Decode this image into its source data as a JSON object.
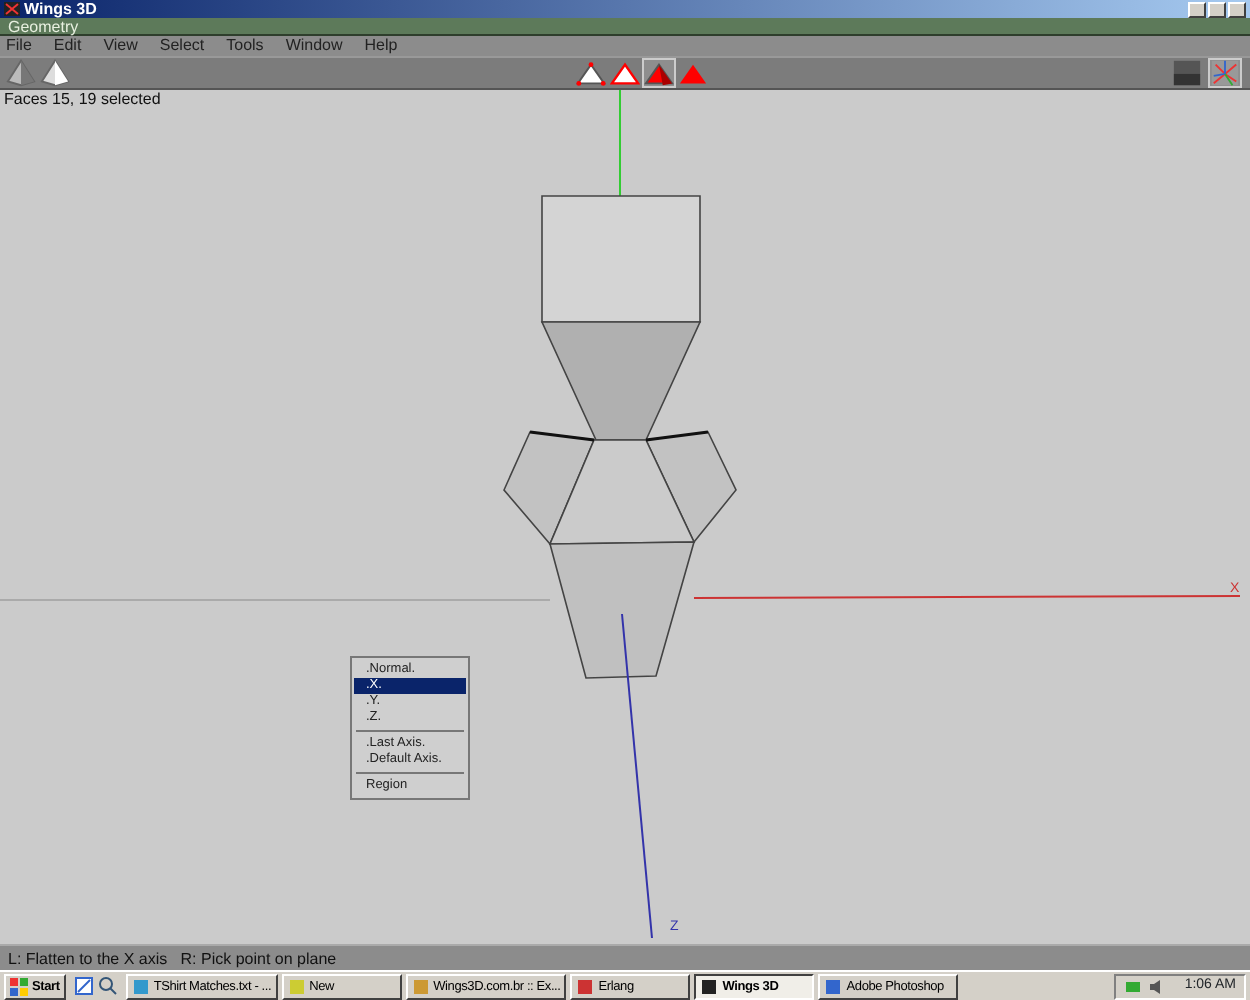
{
  "window": {
    "title": "Wings 3D"
  },
  "geometry_window": {
    "title": "Geometry"
  },
  "menu": [
    "File",
    "Edit",
    "View",
    "Select",
    "Tools",
    "Window",
    "Help"
  ],
  "view_buttons": [
    {
      "kind": "solid"
    },
    {
      "kind": "half"
    }
  ],
  "select_modes": [
    {
      "kind": "vertex",
      "selected": false
    },
    {
      "kind": "edge",
      "selected": false
    },
    {
      "kind": "face",
      "selected": true
    },
    {
      "kind": "body",
      "selected": false
    }
  ],
  "shading_buttons": [
    {
      "kind": "smooth",
      "selected": false
    },
    {
      "kind": "axes",
      "selected": true
    }
  ],
  "viewport": {
    "info": "Faces 15, 19 selected",
    "axis_labels": [
      {
        "kind": "x",
        "text": "X"
      },
      {
        "kind": "z",
        "text": "Z"
      }
    ]
  },
  "popup_menu": [
    {
      "kind": "item",
      "label": ".Normal.",
      "selected": false
    },
    {
      "kind": "item",
      "label": ".X.",
      "selected": true
    },
    {
      "kind": "item",
      "label": ".Y.",
      "selected": false
    },
    {
      "kind": "item",
      "label": ".Z.",
      "selected": false
    },
    {
      "kind": "separator"
    },
    {
      "kind": "item",
      "label": ".Last Axis.",
      "selected": false
    },
    {
      "kind": "item",
      "label": ".Default Axis.",
      "selected": false
    },
    {
      "kind": "separator"
    },
    {
      "kind": "item",
      "label": "Region",
      "selected": false
    }
  ],
  "status_bar": "L: Flatten to the X axis   R: Pick point on plane",
  "taskbar": {
    "start": "Start",
    "tasks": [
      {
        "label": "TShirt Matches.txt - ...",
        "selected": false
      },
      {
        "label": "New",
        "selected": false
      },
      {
        "label": "Wings3D.com.br :: Ex...",
        "selected": false
      },
      {
        "label": "Erlang",
        "selected": false
      },
      {
        "label": "Wings 3D",
        "selected": true
      },
      {
        "label": "Adobe Photoshop",
        "selected": false
      }
    ],
    "clock": "1:06 AM"
  }
}
